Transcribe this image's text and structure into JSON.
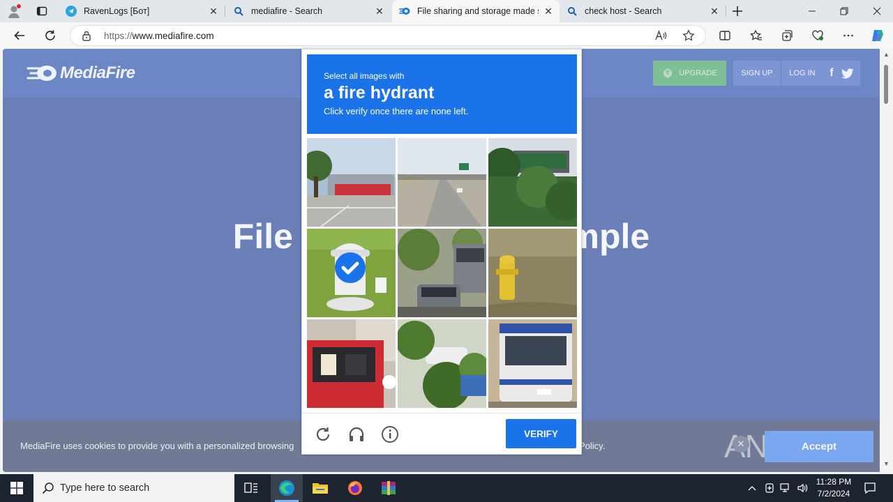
{
  "browser": {
    "tabs": [
      {
        "title": "RavenLogs [Бот]",
        "icon": "telegram-icon",
        "active": false
      },
      {
        "title": "mediafire - Search",
        "icon": "search-icon",
        "active": false
      },
      {
        "title": "File sharing and storage made simple",
        "icon": "mediafire-icon",
        "active": true
      },
      {
        "title": "check host - Search",
        "icon": "search-icon",
        "active": false
      }
    ],
    "address": {
      "scheme": "https://",
      "host": "www.mediafire.com"
    }
  },
  "site": {
    "logo_text": "MediaFire",
    "upgrade_label": "UPGRADE",
    "signup_label": "SIGN UP",
    "login_label": "LOG IN",
    "facebook_glyph": "f",
    "hero_title": "File storage made simple",
    "cookie_text": "MediaFire uses cookies to provide you with a personalized browsing",
    "cookie_text_end": "Policy.",
    "cookie_close": "✕",
    "accept_label": "Accept",
    "watermark": "ANY RUN"
  },
  "captcha": {
    "prompt_pre": "Select all images with",
    "prompt_object": "a fire hydrant",
    "prompt_post": "Click verify once there are none left.",
    "verify_label": "VERIFY",
    "tiles": [
      {
        "scene": "parking lot with red trucks",
        "selected": false
      },
      {
        "scene": "highway overpass",
        "selected": false
      },
      {
        "scene": "highway sign among trees",
        "selected": false
      },
      {
        "scene": "white fire hydrant on grass",
        "selected": true
      },
      {
        "scene": "parked cars on street",
        "selected": false
      },
      {
        "scene": "yellow fire hydrant in field",
        "selected": false
      },
      {
        "scene": "red bus interior",
        "selected": false
      },
      {
        "scene": "car behind bushes",
        "selected": false
      },
      {
        "scene": "white bus",
        "selected": false
      }
    ]
  },
  "taskbar": {
    "search_placeholder": "Type here to search",
    "time": "11:28 PM",
    "date": "7/2/2024"
  },
  "colors": {
    "captcha_blue": "#1a73e8",
    "site_overlay": "#6a7fb8",
    "upgrade_green": "#7ec096"
  }
}
